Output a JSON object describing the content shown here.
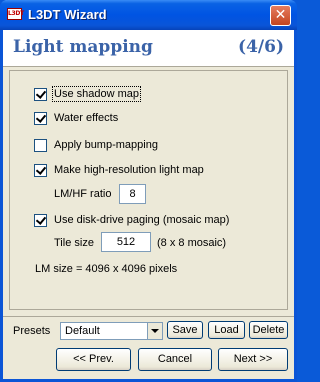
{
  "window": {
    "title": "L3DT Wizard",
    "app_icon_text": "L3DT",
    "close_glyph": "✕"
  },
  "header": {
    "title": "Light mapping",
    "step": "(4/6)"
  },
  "options": {
    "shadow_map": {
      "label": "Use shadow map",
      "checked": true
    },
    "water_effects": {
      "label": "Water effects",
      "checked": true
    },
    "bump_mapping": {
      "label": "Apply bump-mapping",
      "checked": false
    },
    "hires_light_map": {
      "label": "Make high-resolution light map",
      "checked": true
    },
    "lm_hf_ratio": {
      "label": "LM/HF ratio",
      "value": "8"
    },
    "disk_paging": {
      "label": "Use disk-drive paging (mosaic map)",
      "checked": true
    },
    "tile_size": {
      "label": "Tile size",
      "value": "512",
      "note": "(8 x 8 mosaic)"
    },
    "lm_size": "LM size = 4096 x 4096 pixels"
  },
  "presets": {
    "label": "Presets",
    "selected": "Default",
    "save": "Save",
    "load": "Load",
    "delete": "Delete"
  },
  "nav": {
    "prev": "<< Prev.",
    "cancel": "Cancel",
    "next": "Next >>"
  },
  "colors": {
    "titlebar": "#0054e3",
    "header_text": "#3b63a8",
    "dialog_bg": "#ece9d8"
  }
}
